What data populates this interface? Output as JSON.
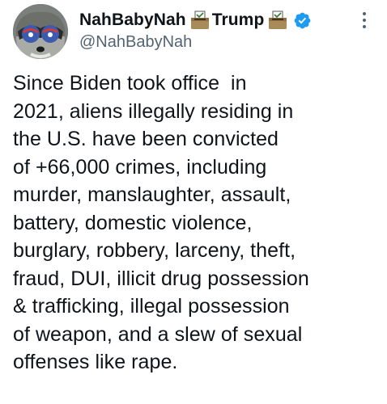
{
  "author": {
    "name_part1": "NahBabyNah",
    "name_part2": "Trump",
    "handle": "@NahBabyNah",
    "avatar_icon": "raccoon-avatar",
    "badge_icon": "verified-badge-icon",
    "name_emoji_icon": "ballot-box-icon"
  },
  "tweet": {
    "lines": [
      "Since Biden took office  in",
      "2021, aliens illegally residing in",
      "the U.S. have been convicted",
      "of +66,000 crimes, including",
      "murder, manslaughter, assault,",
      "battery, domestic violence,",
      "burglary, robbery, larceny, theft,",
      "fraud, DUI, illicit drug possession",
      "& trafficking, illegal possession",
      "of weapon, and a slew of sexual",
      "offenses like rape."
    ]
  },
  "colors": {
    "text": "#0f1419",
    "secondary": "#536471",
    "verified": "#1d9bf0"
  }
}
